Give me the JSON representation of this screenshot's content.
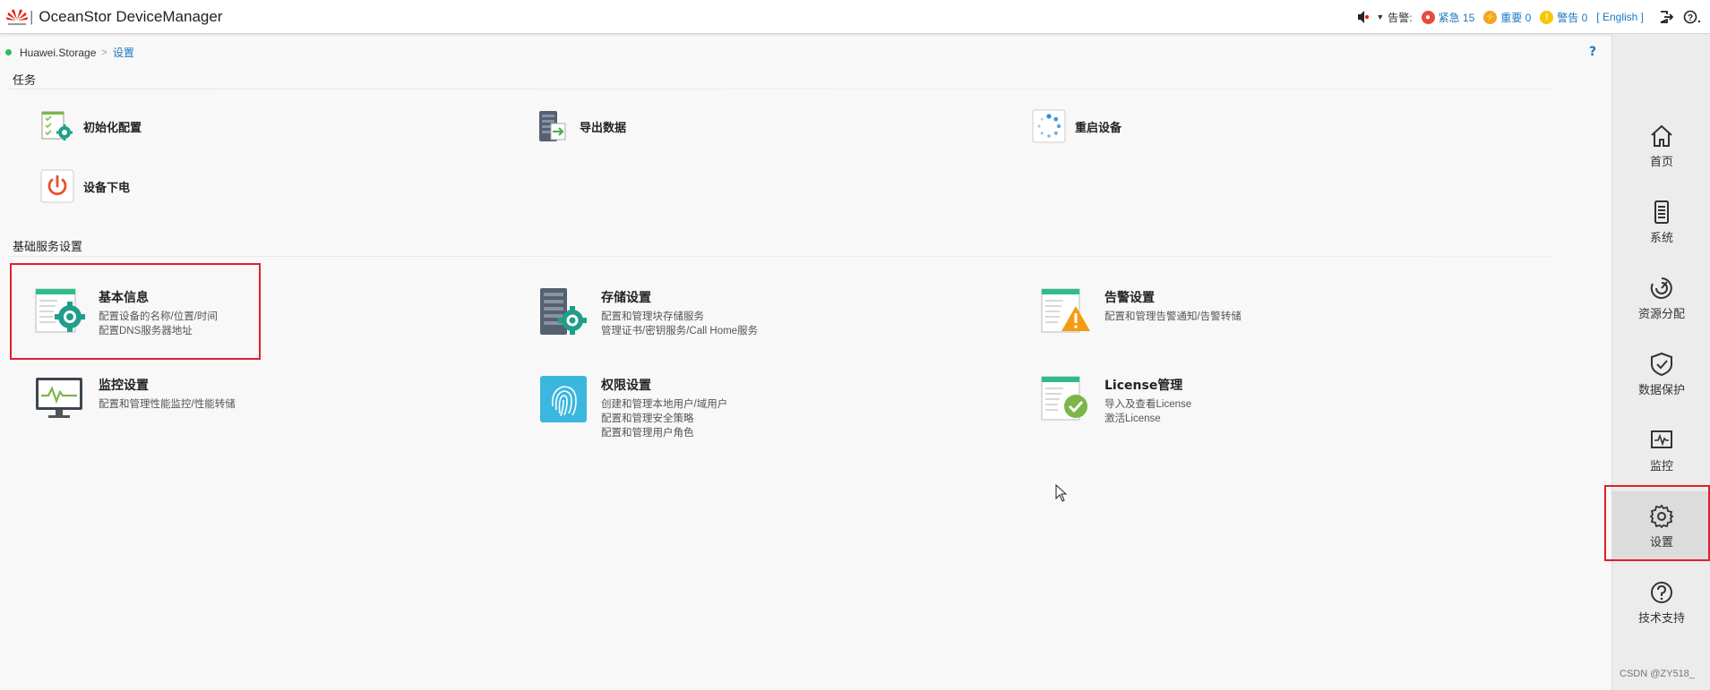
{
  "header": {
    "app_title": "OceanStor DeviceManager",
    "alarm_label": "告警:",
    "alarms": [
      {
        "label": "紧急 15",
        "color": "#e84a3c"
      },
      {
        "label": "重要 0",
        "color": "#f2a32a"
      },
      {
        "label": "警告 0",
        "color": "#f5c800"
      }
    ],
    "language": "[ English ]"
  },
  "breadcrumb": {
    "home": "Huawei.Storage",
    "current": "设置",
    "help": "?"
  },
  "tasks": {
    "title": "任务",
    "items": [
      {
        "label": "初始化配置",
        "icon": "init-config-icon"
      },
      {
        "label": "导出数据",
        "icon": "export-data-icon"
      },
      {
        "label": "重启设备",
        "icon": "restart-icon"
      },
      {
        "label": "设备下电",
        "icon": "power-off-icon"
      }
    ]
  },
  "basic": {
    "title": "基础服务设置",
    "items": [
      {
        "name": "基本信息",
        "desc": [
          "配置设备的名称/位置/时间",
          "配置DNS服务器地址"
        ]
      },
      {
        "name": "存储设置",
        "desc": [
          "配置和管理块存储服务",
          "管理证书/密钥服务/Call Home服务"
        ]
      },
      {
        "name": "告警设置",
        "desc": [
          "配置和管理告警通知/告警转储"
        ]
      },
      {
        "name": "监控设置",
        "desc": [
          "配置和管理性能监控/性能转储"
        ]
      },
      {
        "name": "权限设置",
        "desc": [
          "创建和管理本地用户/域用户",
          "配置和管理安全策略",
          "配置和管理用户角色"
        ]
      },
      {
        "name": "License管理",
        "desc": [
          "导入及查看License",
          "激活License"
        ]
      }
    ]
  },
  "sidebar": {
    "items": [
      {
        "label": "首页",
        "icon": "home-icon"
      },
      {
        "label": "系统",
        "icon": "system-icon"
      },
      {
        "label": "资源分配",
        "icon": "resource-icon"
      },
      {
        "label": "数据保护",
        "icon": "shield-icon"
      },
      {
        "label": "监控",
        "icon": "monitor-icon"
      },
      {
        "label": "设置",
        "icon": "gear-icon",
        "active": true
      },
      {
        "label": "技术支持",
        "icon": "help-icon"
      }
    ]
  },
  "watermark": "CSDN @ZY518_"
}
